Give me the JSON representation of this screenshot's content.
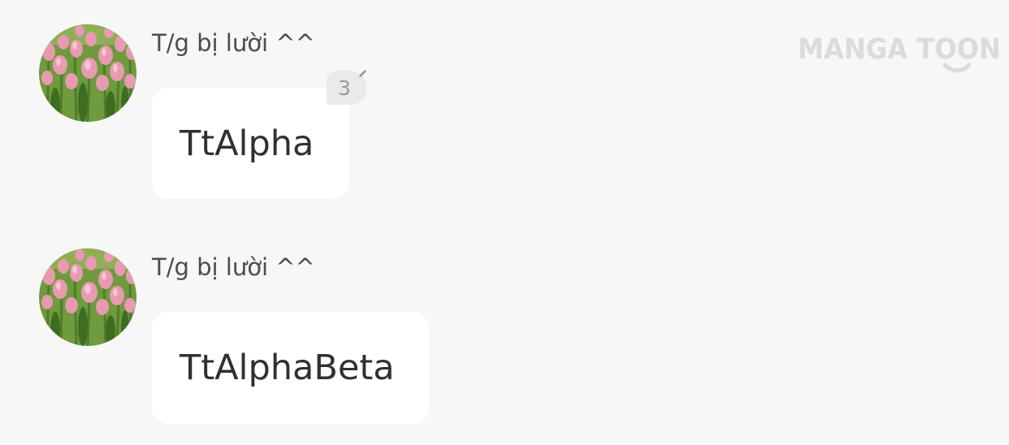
{
  "watermark": {
    "text": "MANGA TOON"
  },
  "messages": [
    {
      "author": "T/g bị lười ^^",
      "text": "TtAlpha",
      "comment_count": "3",
      "avatar_icon": "tulip-field-avatar"
    },
    {
      "author": "T/g bị lười ^^",
      "text": "TtAlphaBeta",
      "avatar_icon": "tulip-field-avatar"
    }
  ],
  "colors": {
    "background": "#f7f7f8",
    "bubble": "#ffffff",
    "author_text": "#4c4c4c",
    "message_text": "#303030",
    "badge_bg": "#eaeaea",
    "watermark": "#dbdbdb"
  }
}
